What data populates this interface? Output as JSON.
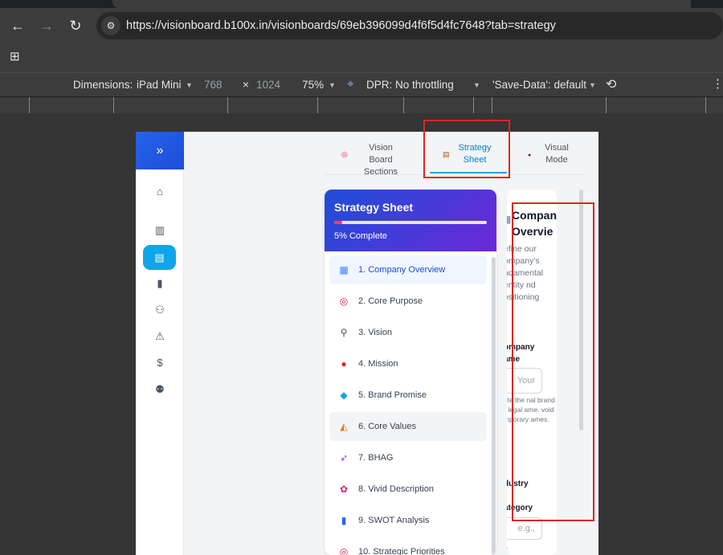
{
  "browser": {
    "url": "https://visionboard.b100x.in/visionboards/69eb396099d4f6f5d4fc7648?tab=strategy",
    "back_icon": "back-arrow-icon",
    "forward_icon": "forward-arrow-icon",
    "reload_icon": "reload-icon"
  },
  "devtools": {
    "dimensions_label": "Dimensions:",
    "device": "iPad Mini",
    "width": "768",
    "times": "×",
    "height": "1024",
    "zoom": "75%",
    "dpr_label": "DPR:",
    "throttling": "No throttling",
    "save_data": "'Save-Data': default"
  },
  "app": {
    "sidebar": {
      "expand_glyph": "»",
      "items": [
        {
          "icon": "home-icon",
          "glyph": "⌂"
        },
        {
          "icon": "board-icon",
          "glyph": "▥"
        },
        {
          "icon": "clipboard-icon",
          "glyph": "▤",
          "active": true
        },
        {
          "icon": "bar-chart-icon",
          "glyph": "▮"
        },
        {
          "icon": "team-icon",
          "glyph": "⚇"
        },
        {
          "icon": "warning-icon",
          "glyph": "⚠"
        },
        {
          "icon": "dollar-icon",
          "glyph": "$"
        },
        {
          "icon": "users-icon",
          "glyph": "⚉"
        }
      ]
    },
    "tabs": [
      {
        "line1": "Vision Board",
        "line2": "Sections",
        "icon": "target-icon",
        "glyph": "◎"
      },
      {
        "line1": "Strategy",
        "line2": "Sheet",
        "icon": "clipboard-icon",
        "glyph": "▤",
        "active": true
      },
      {
        "line1": "Visual",
        "line2": "Mode",
        "icon": "eye-icon",
        "glyph": "●"
      }
    ],
    "strategy_card": {
      "title": "Strategy Sheet",
      "progress": 5,
      "progress_label": "5% Complete",
      "items": [
        {
          "label": "1. Company Overview",
          "glyph": "▦",
          "icon": "building-icon"
        },
        {
          "label": "2. Core Purpose",
          "glyph": "◎",
          "icon": "target-icon"
        },
        {
          "label": "3. Vision",
          "glyph": "⚲",
          "icon": "telescope-icon"
        },
        {
          "label": "4. Mission",
          "glyph": "●",
          "icon": "pin-icon"
        },
        {
          "label": "5. Brand Promise",
          "glyph": "◆",
          "icon": "diamond-icon"
        },
        {
          "label": "6. Core Values",
          "glyph": "◭",
          "icon": "cake-icon"
        },
        {
          "label": "7. BHAG",
          "glyph": "➶",
          "icon": "rocket-icon"
        },
        {
          "label": "8. Vivid Description",
          "glyph": "✿",
          "icon": "palette-icon"
        },
        {
          "label": "9. SWOT Analysis",
          "glyph": "▮",
          "icon": "chart-icon"
        },
        {
          "label": "10. Strategic Priorities",
          "glyph": "◎",
          "icon": "target-icon"
        }
      ]
    },
    "detail": {
      "title_line1": "Compan",
      "title_line2": "Overvie",
      "description": "efine our ompany's ndamental entity nd ositioning",
      "company_name_label_1": "ompany",
      "company_name_label_2": "ame",
      "company_name_placeholder": "Your",
      "hint": "rite the nal brand r legal ame. void mporary ames.",
      "industry_label": "dustry",
      "category_label": "ategory",
      "category_placeholder": "e.g.,",
      "trailing": "e"
    }
  },
  "colors": {
    "accent": "#0ea5e9",
    "header_gradient_start": "#1d4ed8",
    "header_gradient_end": "#6d28d9",
    "progress_fill": "#ef4444",
    "annotation_red": "#dc2626"
  }
}
